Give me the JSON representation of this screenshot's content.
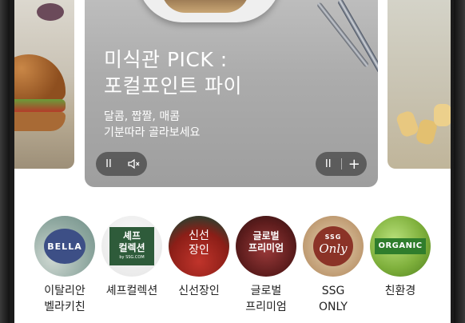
{
  "hero": {
    "title_line1": "미식관 PICK :",
    "title_line2": "포컬포인트 파이",
    "subtitle_line1": "달콤, 짭짤, 매콤",
    "subtitle_line2": "기분따라 골라보세요",
    "controls_left": {
      "pause": "II",
      "mute": "🔈×"
    },
    "controls_right": {
      "pause": "II",
      "more": "+"
    }
  },
  "categories": [
    {
      "id": "bella",
      "line1": "이탈리안",
      "line2": "벨라키친",
      "badge": "BELLA"
    },
    {
      "id": "chef",
      "line1": "셰프컬렉션",
      "line2": "",
      "badge_line1": "셰프",
      "badge_line2": "컬렉션",
      "badge_small": "by SSG.COM"
    },
    {
      "id": "fresh",
      "line1": "신선장인",
      "line2": "",
      "badge_line1": "신선",
      "badge_line2": "장인"
    },
    {
      "id": "global",
      "line1": "글로벌",
      "line2": "프리미엄",
      "badge_line1": "글로벌",
      "badge_line2": "프리미엄"
    },
    {
      "id": "ssg",
      "line1": "SSG",
      "line2": "ONLY",
      "badge_top": "SSG",
      "badge_script": "Only"
    },
    {
      "id": "organic",
      "line1": "친환경",
      "line2": "",
      "badge": "ORGANIC"
    }
  ]
}
